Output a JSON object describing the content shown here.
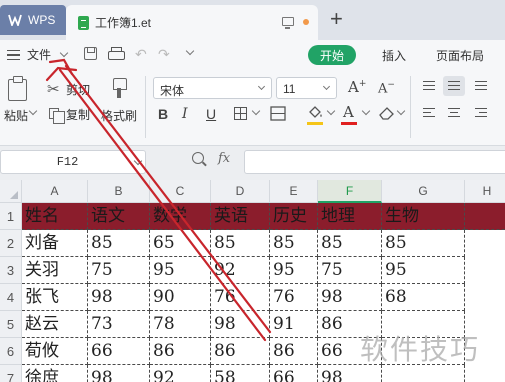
{
  "tabbar": {
    "app_tab_label": "WPS",
    "doc_tab_label": "工作簿1.et",
    "new_tab_symbol": "+"
  },
  "menubar": {
    "file_label": "文件",
    "start_tab": "开始",
    "insert_tab": "插入",
    "page_layout_tab": "页面布局"
  },
  "ribbon": {
    "paste_label": "粘贴",
    "cut_label": "剪切",
    "copy_label": "复制",
    "format_painter_label": "格式刷",
    "font_name": "宋体",
    "font_size": "11",
    "bold": "B",
    "italic": "I",
    "underline": "U",
    "grow_font": "A",
    "shrink_font": "A",
    "font_color_glyph": "A"
  },
  "formula_bar": {
    "name_box": "F12",
    "fx_label": "fx",
    "formula_value": ""
  },
  "grid": {
    "columns": [
      "A",
      "B",
      "C",
      "D",
      "E",
      "F",
      "G",
      "H"
    ],
    "active_column": "F",
    "row_numbers": [
      "1",
      "2",
      "3",
      "4",
      "5",
      "6",
      "7"
    ],
    "header_row": [
      "姓名",
      "语文",
      "数学",
      "英语",
      "历史",
      "地理",
      "生物"
    ],
    "rows": [
      [
        "刘备",
        "85",
        "65",
        "85",
        "85",
        "85",
        "85"
      ],
      [
        "关羽",
        "75",
        "95",
        "92",
        "95",
        "75",
        "95"
      ],
      [
        "张飞",
        "98",
        "90",
        "76",
        "76",
        "98",
        "68"
      ],
      [
        "赵云",
        "73",
        "78",
        "98",
        "91",
        "86",
        ""
      ],
      [
        "荀攸",
        "66",
        "86",
        "86",
        "86",
        "66",
        ""
      ],
      [
        "徐庶",
        "98",
        "92",
        "58",
        "66",
        "98",
        ""
      ]
    ]
  },
  "colors": {
    "accent_green": "#21a366",
    "header_fill": "#8b1d2c",
    "arrow_red": "#c8252c"
  },
  "watermark": "软件技巧"
}
